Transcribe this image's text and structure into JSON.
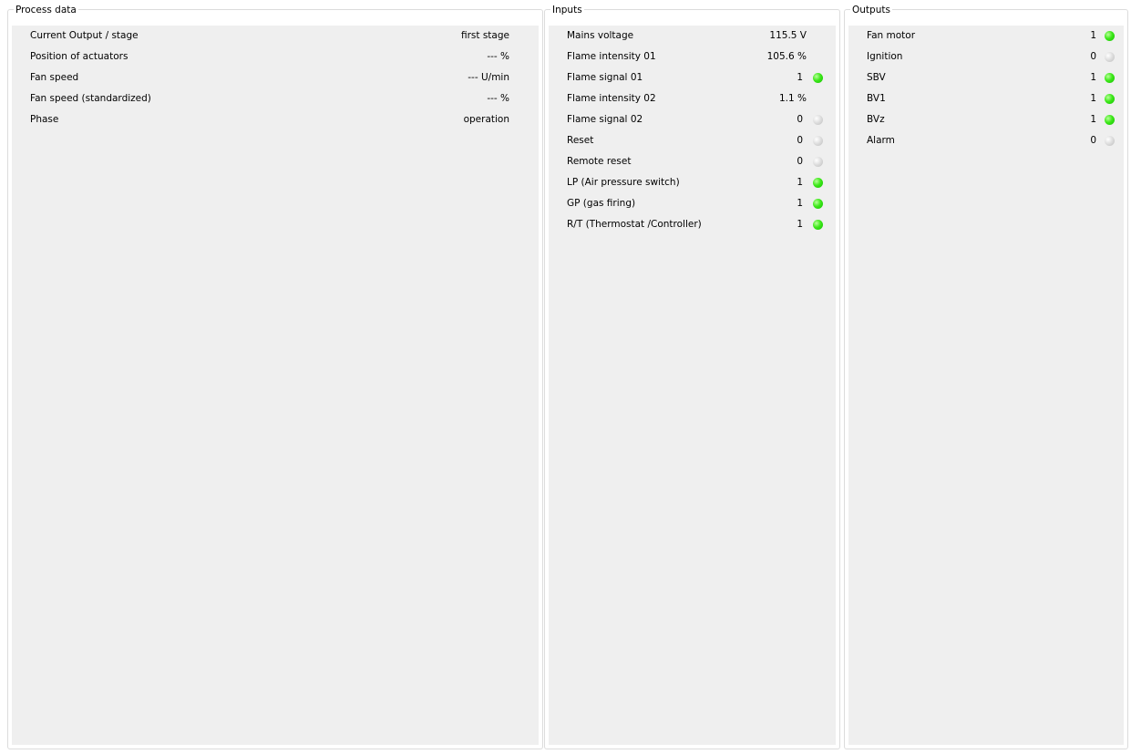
{
  "process_data": {
    "title": "Process data",
    "rows": [
      {
        "label": "Current Output / stage",
        "value": "first stage"
      },
      {
        "label": "Position of actuators",
        "value": "--- %"
      },
      {
        "label": "Fan speed",
        "value": "--- U/min"
      },
      {
        "label": "Fan speed (standardized)",
        "value": "--- %"
      },
      {
        "label": "Phase",
        "value": "operation"
      }
    ]
  },
  "inputs": {
    "title": "Inputs",
    "rows": [
      {
        "label": "Mains voltage",
        "value": "115.5 V",
        "led": null
      },
      {
        "label": "Flame intensity 01",
        "value": "105.6 %",
        "led": null
      },
      {
        "label": "Flame signal 01",
        "value": "1",
        "led": "on"
      },
      {
        "label": "Flame intensity 02",
        "value": "1.1 %",
        "led": null
      },
      {
        "label": "Flame signal 02",
        "value": "0",
        "led": "off"
      },
      {
        "label": "Reset",
        "value": "0",
        "led": "off"
      },
      {
        "label": "Remote reset",
        "value": "0",
        "led": "off"
      },
      {
        "label": "LP (Air pressure switch)",
        "value": "1",
        "led": "on"
      },
      {
        "label": "GP (gas firing)",
        "value": "1",
        "led": "on"
      },
      {
        "label": "R/T (Thermostat /Controller)",
        "value": "1",
        "led": "on"
      }
    ]
  },
  "outputs": {
    "title": "Outputs",
    "rows": [
      {
        "label": "Fan motor",
        "value": "1",
        "led": "on"
      },
      {
        "label": "Ignition",
        "value": "0",
        "led": "off"
      },
      {
        "label": "SBV",
        "value": "1",
        "led": "on"
      },
      {
        "label": "BV1",
        "value": "1",
        "led": "on"
      },
      {
        "label": "BVz",
        "value": "1",
        "led": "on"
      },
      {
        "label": "Alarm",
        "value": "0",
        "led": "off"
      }
    ]
  },
  "colors": {
    "led_on": "#33dd11",
    "led_off": "#c8c8c8",
    "panel_bg": "#efefef"
  }
}
